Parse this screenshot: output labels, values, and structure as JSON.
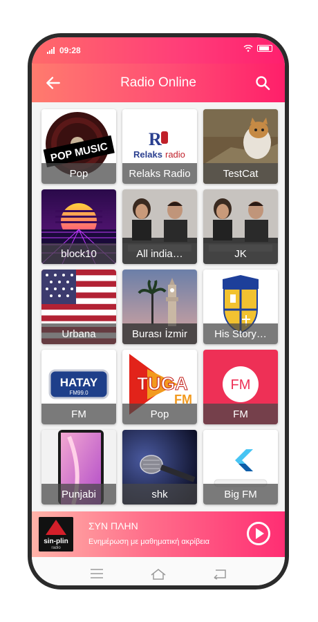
{
  "status": {
    "time": "09:28"
  },
  "header": {
    "title": "Radio Online",
    "back_icon": "arrow-back-icon",
    "search_icon": "search-icon"
  },
  "stations": [
    {
      "label": "Pop",
      "art": "pop-music-vinyl"
    },
    {
      "label": "Relaks Radio",
      "art": "relaks-radio-logo"
    },
    {
      "label": "TestCat",
      "art": "cat-photo"
    },
    {
      "label": "block10",
      "art": "retro-sunset"
    },
    {
      "label": "All india…",
      "art": "studio-hosts"
    },
    {
      "label": "JK",
      "art": "studio-hosts"
    },
    {
      "label": "Urbana",
      "art": "us-flag"
    },
    {
      "label": "Burası İzmir",
      "art": "izmir-clock-tower"
    },
    {
      "label": "His Story…",
      "art": "crest"
    },
    {
      "label": "FM",
      "art": "hatay-fm-logo"
    },
    {
      "label": "Pop",
      "art": "tuga-fm-logo"
    },
    {
      "label": "FM",
      "art": "fm-circle-logo"
    },
    {
      "label": "Punjabi",
      "art": "phone-screen"
    },
    {
      "label": "shk",
      "art": "microphone"
    },
    {
      "label": "Big FM",
      "art": "flutter-logo"
    }
  ],
  "player": {
    "logo_text": "sin-plin",
    "logo_subtext": "radio",
    "title": "ΣΥΝ ΠΛΗΝ",
    "subtitle": "Ενημέρωση με μαθηματική ακρίβεια",
    "play_icon": "play-circle-icon"
  },
  "art_text": {
    "pop_music": "POP MUSIC",
    "relaks": "Relaks",
    "radio": "radio",
    "hatay": "HATAY",
    "hatay_freq": "FM99.0",
    "tuga": "TUGA",
    "fm": "FM"
  },
  "colors": {
    "accent": "#ff2e73",
    "accent_light": "#ff7b6e"
  }
}
